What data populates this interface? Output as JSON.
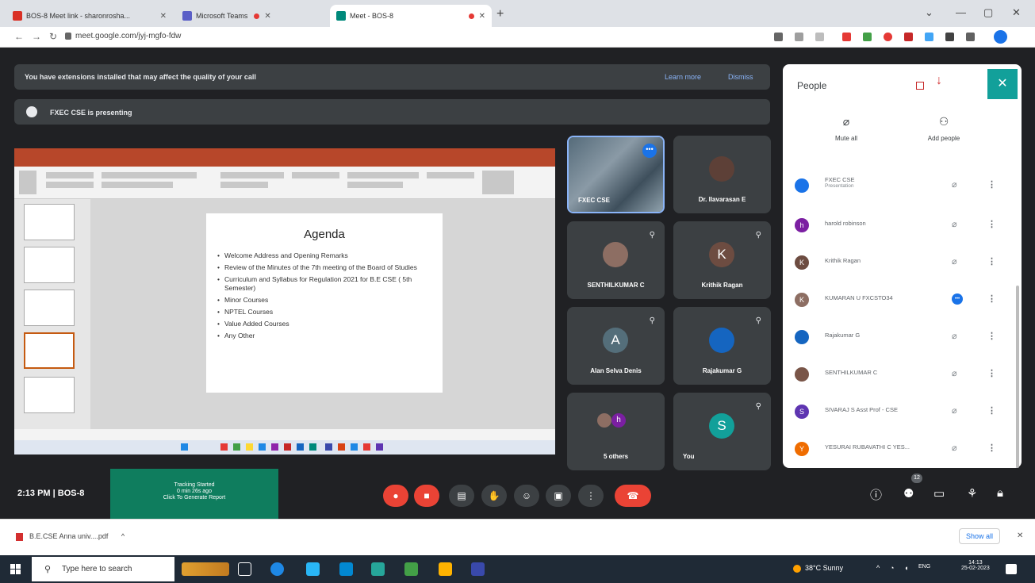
{
  "browser": {
    "tabs": [
      {
        "title": "BOS-8 Meet link - sharonrosha...",
        "favicon_color": "#d93025",
        "active": false
      },
      {
        "title": "Microsoft Teams",
        "favicon_color": "#5b5fc7",
        "active": false
      },
      {
        "title": "Meet - BOS-8",
        "favicon_color": "#00897b",
        "active": true
      }
    ],
    "new_tab": "+",
    "url": "meet.google.com/jyj-mgfo-fdw"
  },
  "meet": {
    "extension_banner": {
      "message": "You have extensions installed that may affect the quality of your call",
      "learn_more": "Learn more",
      "dismiss": "Dismiss"
    },
    "presenting_label": "FXEC CSE is presenting",
    "slide": {
      "title": "Agenda",
      "items": [
        "Welcome Address and Opening Remarks",
        "Review of the Minutes of the 7th meeting of the Board of Studies",
        "Curriculum and Syllabus for Regulation 2021 for B.E CSE ( 5th Semester)",
        "Minor Courses",
        "NPTEL Courses",
        "Value Added Courses",
        "Any Other"
      ]
    },
    "tiles": [
      {
        "name": "FXEC CSE",
        "avatar": "",
        "color": "#556b7a"
      },
      {
        "name": "Dr. Ilavarasan E",
        "avatar": "",
        "color": "#5d4037"
      },
      {
        "name": "SENTHILKUMAR C",
        "avatar": "",
        "color": "#8d6e63"
      },
      {
        "name": "Krithik Ragan",
        "avatar": "K",
        "color": "#6d4c41"
      },
      {
        "name": "Alan Selva Denis",
        "avatar": "A",
        "color": "#546e7a"
      },
      {
        "name": "Rajakumar G",
        "avatar": "",
        "color": "#1565c0"
      },
      {
        "name": "5 others",
        "avatar": "h",
        "color": "#7b1fa2"
      },
      {
        "name": "You",
        "avatar": "S",
        "color": "#12a09a"
      }
    ],
    "time": "2:13 PM",
    "separator": "|",
    "meeting_code": "BOS-8",
    "tracking": {
      "line1": "Tracking Started",
      "line2": "0 min 26s ago",
      "line3": "Click To Generate Report"
    },
    "participant_count": "12"
  },
  "people_panel": {
    "title": "People",
    "mute_all": "Mute all",
    "add_people": "Add people",
    "participants": [
      {
        "name": "FXEC CSE",
        "sub": "Presentation",
        "initial": "",
        "color": "#1a73e8"
      },
      {
        "name": "harold robinson",
        "sub": "",
        "initial": "h",
        "color": "#7b1fa2"
      },
      {
        "name": "Krithik Ragan",
        "sub": "",
        "initial": "K",
        "color": "#6d4c41"
      },
      {
        "name": "KUMARAN U FXCSTO34",
        "sub": "",
        "initial": "K",
        "color": "#8d6e63"
      },
      {
        "name": "Rajakumar G",
        "sub": "",
        "initial": "",
        "color": "#1565c0"
      },
      {
        "name": "SENTHILKUMAR C",
        "sub": "",
        "initial": "",
        "color": "#795548"
      },
      {
        "name": "SIVARAJ S Asst Prof - CSE",
        "sub": "",
        "initial": "S",
        "color": "#5e35b1"
      },
      {
        "name": "YESURAI RUBAVATHI C YES...",
        "sub": "",
        "initial": "Y",
        "color": "#ef6c00"
      }
    ]
  },
  "downloads": {
    "file": "B.E.CSE Anna univ....pdf",
    "show_all": "Show all"
  },
  "taskbar": {
    "search_placeholder": "Type here to search",
    "weather": "38°C Sunny",
    "lang": "ENG",
    "clock_time": "14:13",
    "clock_date": "25-02-2023"
  },
  "colors": {
    "meet_bg": "#202124",
    "tile_bg": "#3c4043",
    "accent_teal": "#12a09a",
    "end_call_red": "#ea4335",
    "tracking_green": "#0f7d5e"
  }
}
